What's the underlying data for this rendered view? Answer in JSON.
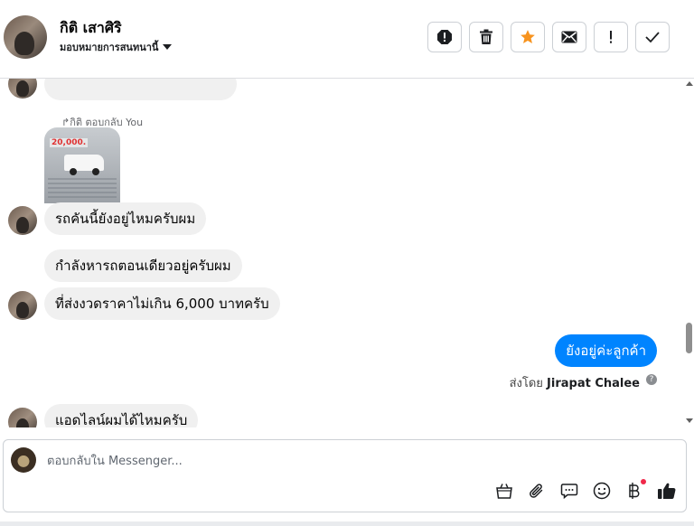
{
  "header": {
    "contact_name": "กิติ เสาศิริ",
    "assign_label": "มอบหมายการสนทนานี้",
    "actions": [
      {
        "name": "report-spam-button",
        "icon": "alert-octagon-icon"
      },
      {
        "name": "delete-button",
        "icon": "trash-icon"
      },
      {
        "name": "star-button",
        "icon": "star-icon"
      },
      {
        "name": "mark-unread-button",
        "icon": "envelope-icon"
      },
      {
        "name": "mark-important-button",
        "icon": "exclamation-icon"
      },
      {
        "name": "mark-done-button",
        "icon": "checkmark-icon"
      }
    ]
  },
  "thread": {
    "reply_meta": "กิติ ตอบกลับ You",
    "image_banner": "20,000.",
    "messages": [
      {
        "side": "in",
        "text": "รถคันนี้ยังอยู่ไหมครับผม"
      },
      {
        "side": "in",
        "text": "กำลังหารถตอนเดียวอยู่ครับผม"
      },
      {
        "side": "in",
        "text": "ที่ส่งงวดราคาไม่เกิน 6,000 บาทครับ"
      },
      {
        "side": "out",
        "text": "ยังอยู่ค่ะลูกค้า"
      },
      {
        "side": "in",
        "text": "แอดไลน์ผมได้ไหมครับ"
      }
    ],
    "sent_by_prefix": "ส่งโดย",
    "sent_by_name": "Jirapat Chalee",
    "help_glyph": "?"
  },
  "composer": {
    "placeholder": "ตอบกลับใน Messenger...",
    "tools": [
      "shopping-bag-icon",
      "paperclip-icon",
      "chat-bubble-icon",
      "emoji-icon",
      "baht-icon",
      "thumbs-up-icon"
    ]
  },
  "colors": {
    "accent": "#0084ff",
    "star": "#f7931e",
    "incoming_bubble": "#f0f0f0"
  }
}
